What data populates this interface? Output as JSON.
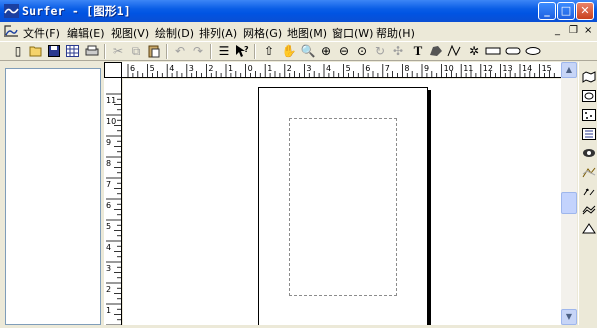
{
  "window": {
    "title": "Surfer - [图形1]"
  },
  "caption_buttons": {
    "minimize": "_",
    "maximize": "□",
    "close": "✕"
  },
  "menu": {
    "items": [
      "文件(F)",
      "编辑(E)",
      "视图(V)",
      "绘制(D)",
      "排列(A)",
      "网格(G)",
      "地图(M)",
      "窗口(W)",
      "帮助(H)"
    ],
    "mdi": {
      "minimize": "_",
      "restore": "❐",
      "close": "×"
    }
  },
  "rulers": {
    "top_labels": [
      "6",
      "5",
      "4",
      "3",
      "2",
      "1",
      "0",
      "1",
      "2",
      "3",
      "4",
      "5",
      "6",
      "7",
      "8",
      "9",
      "10",
      "11",
      "12",
      "13",
      "14",
      "15"
    ],
    "left_labels": [
      "11",
      "10",
      "9",
      "8",
      "7",
      "6",
      "5",
      "4",
      "3",
      "2",
      "1",
      "0"
    ]
  },
  "colors": {
    "titlebar": "#0054e3",
    "workspace": "#ece9d8",
    "canvas": "#ffffff"
  }
}
